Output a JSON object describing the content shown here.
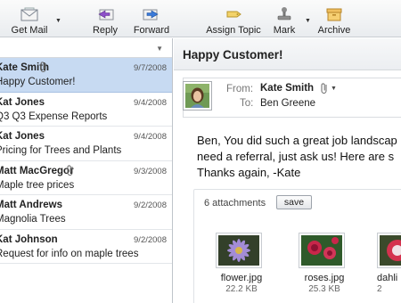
{
  "toolbar": {
    "get_mail": "Get Mail",
    "reply": "Reply",
    "forward": "Forward",
    "assign_topic": "Assign Topic",
    "mark": "Mark",
    "archive": "Archive"
  },
  "messages": [
    {
      "from": "Kate Smith",
      "subject": "Happy Customer!",
      "date": "9/7/2008",
      "attachment": true,
      "selected": true
    },
    {
      "from": "Kat Jones",
      "subject": "Q3 Q3 Expense Reports",
      "date": "9/4/2008",
      "attachment": false
    },
    {
      "from": "Kat Jones",
      "subject": "Pricing for Trees and Plants",
      "date": "9/4/2008",
      "attachment": false
    },
    {
      "from": "Matt MacGregor",
      "subject": "Maple tree prices",
      "date": "9/3/2008",
      "attachment": true
    },
    {
      "from": "Matt Andrews",
      "subject": "Magnolia Trees",
      "date": "9/2/2008",
      "attachment": false
    },
    {
      "from": "Kat Johnson",
      "subject": "Request for info on maple trees",
      "date": "9/2/2008",
      "attachment": false
    }
  ],
  "reader": {
    "title": "Happy Customer!",
    "from_label": "From:",
    "from_value": "Kate Smith",
    "to_label": "To:",
    "to_value": "Ben Greene",
    "body_line1": "Ben, You did such a great job landscap",
    "body_line2": "need a referral, just ask us! Here are s",
    "body_line3": "Thanks again, -Kate",
    "attachments_label": "6 attachments",
    "save_label": "save",
    "attachments": [
      {
        "name": "flower.jpg",
        "size": "22.2 KB"
      },
      {
        "name": "roses.jpg",
        "size": "25.3 KB"
      },
      {
        "name": "dahli",
        "size": "2"
      }
    ]
  }
}
